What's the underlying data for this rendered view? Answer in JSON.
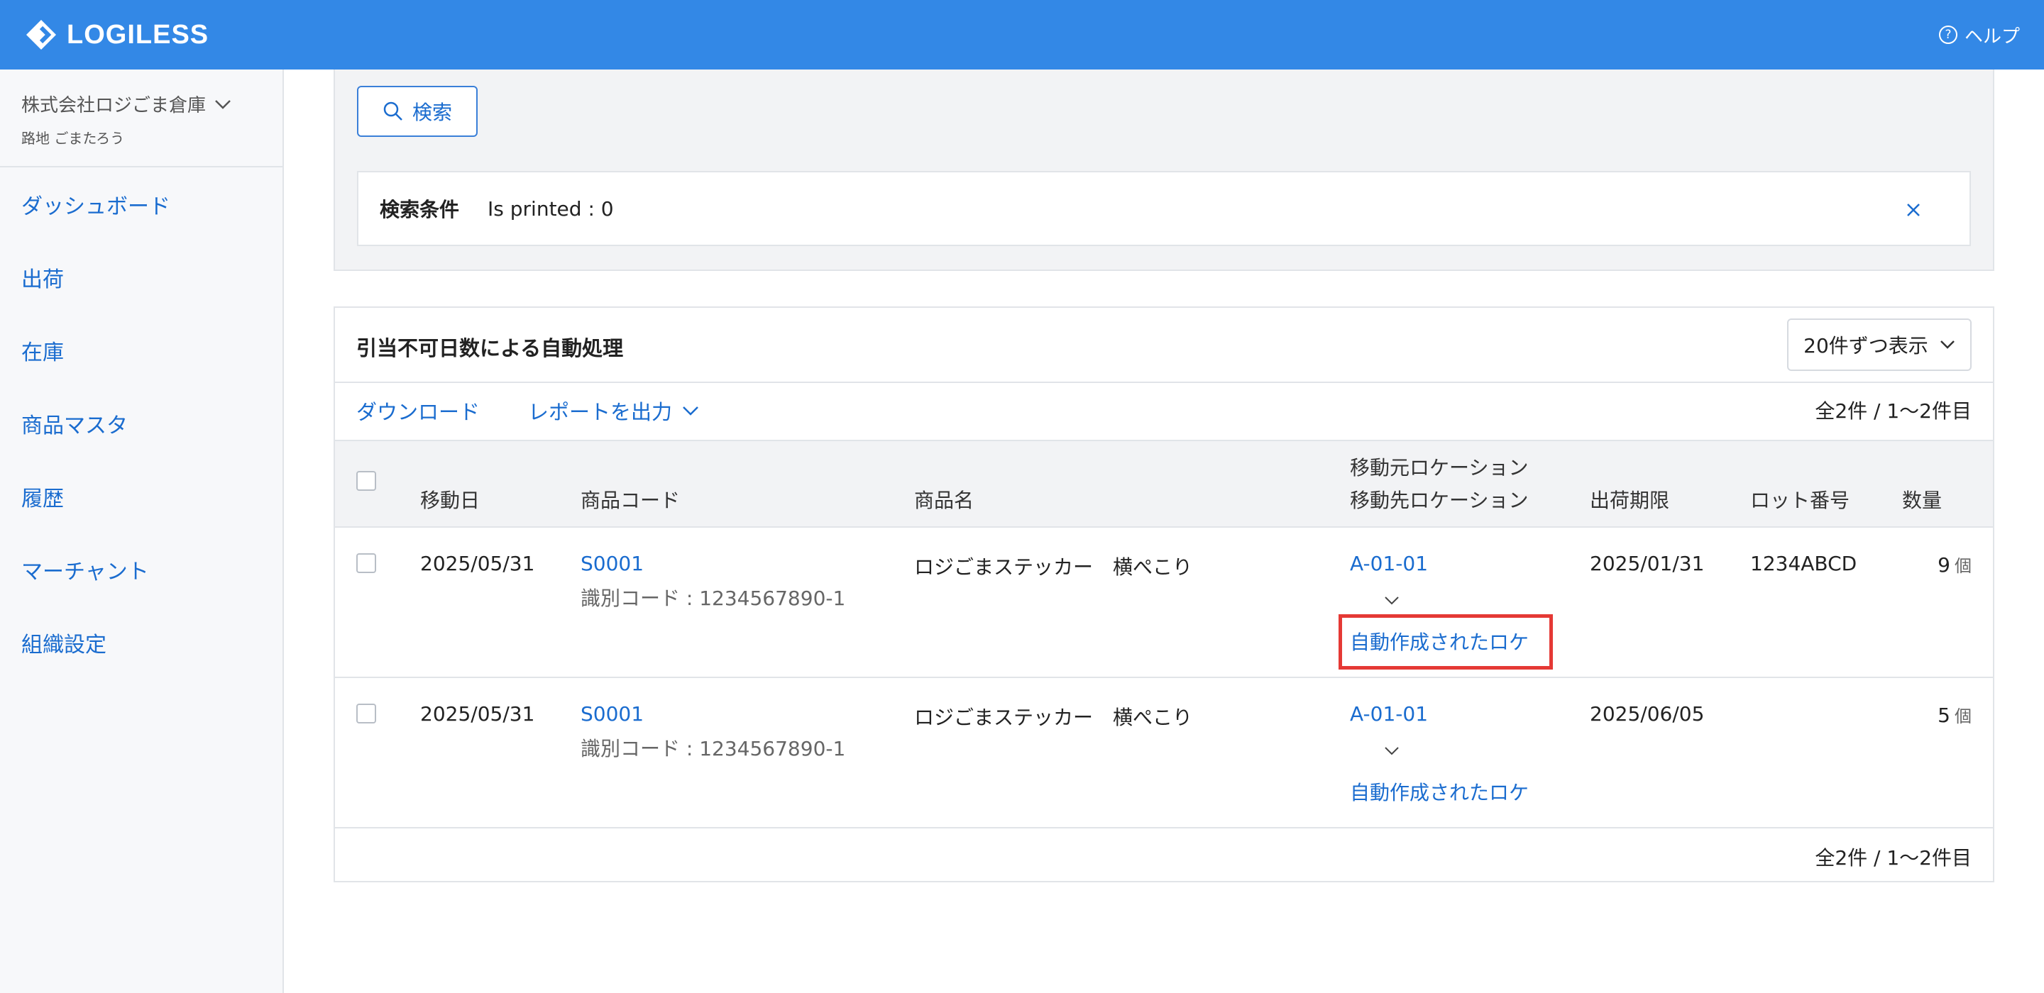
{
  "app": {
    "logo_text": "LOGILESS",
    "help_label": "ヘルプ"
  },
  "sidebar": {
    "company": "株式会社ロジごま倉庫",
    "user": "路地 ごまたろう",
    "items": [
      {
        "label": "ダッシュボード"
      },
      {
        "label": "出荷"
      },
      {
        "label": "在庫"
      },
      {
        "label": "商品マスタ"
      },
      {
        "label": "履歴"
      },
      {
        "label": "マーチャント"
      },
      {
        "label": "組織設定"
      }
    ]
  },
  "search": {
    "button_label": "検索",
    "condition_label": "検索条件",
    "condition_value": "Is printed : 0"
  },
  "results": {
    "title": "引当不可日数による自動処理",
    "per_page": "20件ずつ表示",
    "download": "ダウンロード",
    "report": "レポートを出力",
    "count": "全2件 / 1〜2件目",
    "columns": {
      "move_date": "移動日",
      "product_code": "商品コード",
      "product_name": "商品名",
      "from_location": "移動元ロケーション",
      "to_location": "移動先ロケーション",
      "ship_limit": "出荷期限",
      "lot": "ロット番号",
      "qty": "数量"
    },
    "rows": [
      {
        "move_date": "2025/05/31",
        "product_code": "S0001",
        "id_code": "識別コード : 1234567890-1",
        "product_name": "ロジごまステッカー　横ぺこり",
        "from_location": "A-01-01",
        "to_location": "自動作成されたロケ",
        "ship_limit": "2025/01/31",
        "lot": "1234ABCD",
        "qty": "9",
        "unit": "個"
      },
      {
        "move_date": "2025/05/31",
        "product_code": "S0001",
        "id_code": "識別コード : 1234567890-1",
        "product_name": "ロジごまステッカー　横ぺこり",
        "from_location": "A-01-01",
        "to_location": "自動作成されたロケ",
        "ship_limit": "2025/06/05",
        "lot": "",
        "qty": "5",
        "unit": "個"
      }
    ]
  },
  "colors": {
    "brand": "#3388e6",
    "link": "#1a6ccf",
    "highlight": "#e53935"
  }
}
